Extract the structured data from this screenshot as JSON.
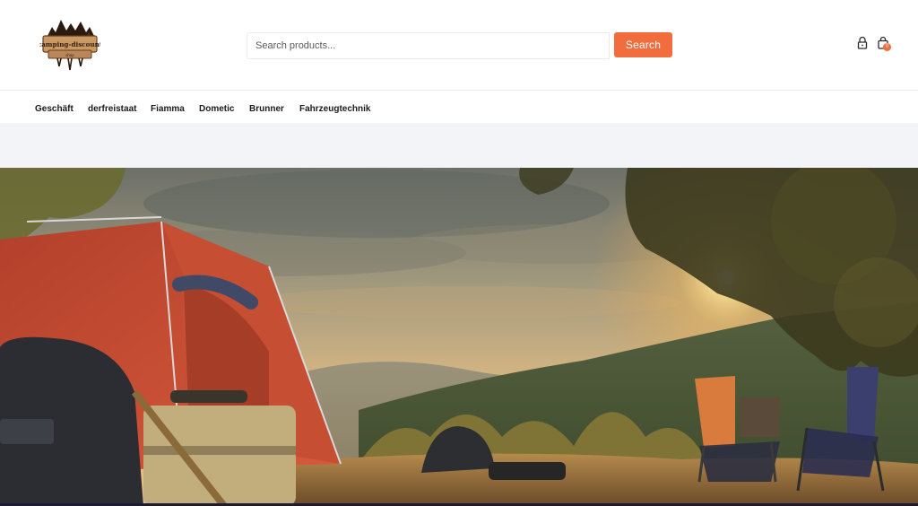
{
  "header": {
    "logo_text": "camping-discount",
    "logo_subtext": "shop",
    "search": {
      "placeholder": "Search products...",
      "value": "",
      "button_label": "Search"
    },
    "cart_count": "0",
    "icons": [
      "lock-icon",
      "shopping-bag-icon"
    ]
  },
  "nav": {
    "items": [
      {
        "label": "Geschäft"
      },
      {
        "label": "derfreistaat"
      },
      {
        "label": "Fiamma"
      },
      {
        "label": "Dometic"
      },
      {
        "label": "Brunner"
      },
      {
        "label": "Fahrzeugtechnik"
      }
    ]
  },
  "colors": {
    "accent": "#f26d3d",
    "band": "#f3f4f7",
    "logo_brown": "#6b3f1f"
  }
}
